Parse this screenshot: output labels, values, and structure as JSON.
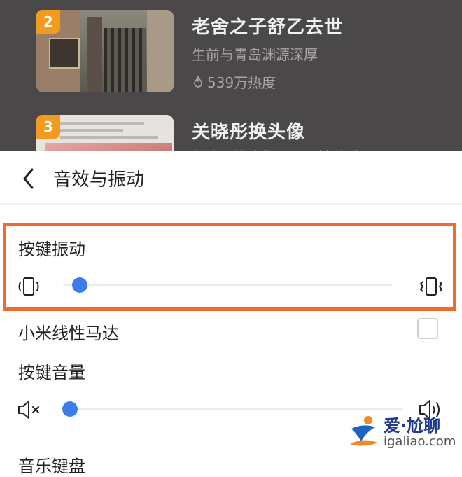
{
  "feed": {
    "items": [
      {
        "rank": "2",
        "title": "老舍之子舒乙去世",
        "subtitle": "生前与青岛渊源深厚",
        "heat": "539万热度"
      },
      {
        "rank": "3",
        "title": "关晓彤换头像",
        "subtitle": "关晓彤换头像，又又被分手"
      }
    ]
  },
  "header": {
    "back_icon": "chevron-left-icon",
    "title": "音效与振动"
  },
  "settings": {
    "key_vibration": {
      "label": "按键振动",
      "level": 0.05,
      "min_icon": "vibrate-weak-icon",
      "max_icon": "vibrate-strong-icon"
    },
    "linear_motor": {
      "label": "小米线性马达",
      "checked": false
    },
    "key_volume": {
      "label": "按键音量",
      "level": 0.02,
      "min_icon": "volume-mute-icon",
      "max_icon": "volume-loud-icon"
    },
    "next_item_label": "音乐键盘"
  },
  "colors": {
    "accent": "#3d7bef",
    "highlight": "#ef6a2c",
    "rank_badge": "#f29b1e"
  },
  "watermark": {
    "brand": "爱·尬聊",
    "url": "igaliao.com"
  }
}
